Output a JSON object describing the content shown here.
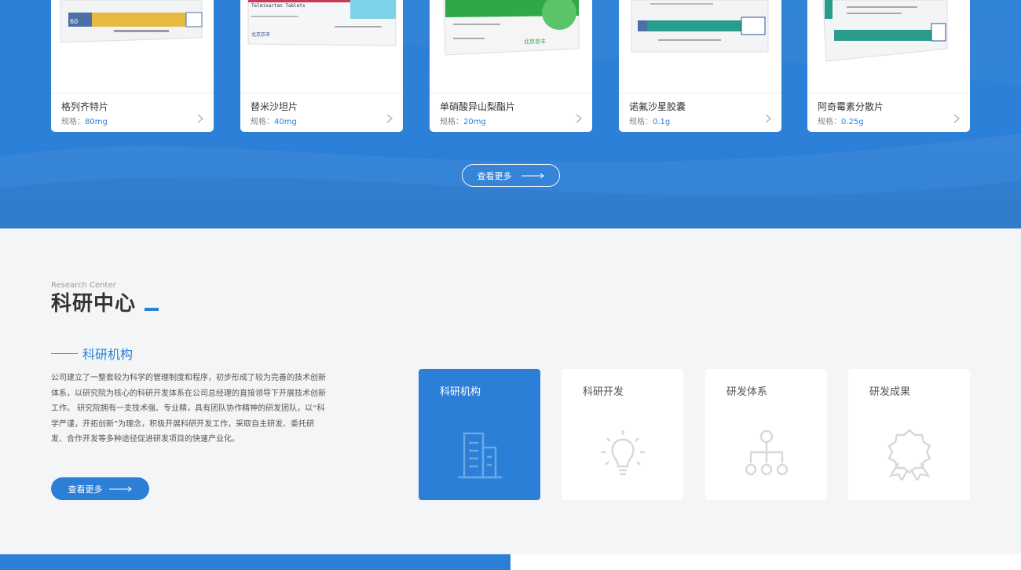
{
  "products": [
    {
      "name": "格列齐特片",
      "spec_label": "规格：",
      "spec_value": "80mg",
      "box_color": "#e8b941"
    },
    {
      "name": "替米沙坦片",
      "spec_label": "规格：",
      "spec_value": "40mg",
      "box_color": "#c83a5a",
      "box_text": "Telmisartan Tablets"
    },
    {
      "name": "单硝酸异山梨酯片",
      "spec_label": "规格：",
      "spec_value": "20mg",
      "box_color": "#2fa84a"
    },
    {
      "name": "诺氟沙星胶囊",
      "spec_label": "规格：",
      "spec_value": "0.1g",
      "box_color": "#2a9c8c"
    },
    {
      "name": "阿奇霉素分散片",
      "spec_label": "规格：",
      "spec_value": "0.25g",
      "box_color": "#2a9c8c"
    }
  ],
  "products_more": "查看更多",
  "research": {
    "en_title": "Research Center",
    "title": "科研中心",
    "subtitle": "科研机构",
    "description": "公司建立了一整套较为科学的管理制度和程序，初步形成了较为完善的技术创新体系，以研究院为核心的科研开发体系在公司总经理的直接领导下开展技术创新工作。 研究院拥有一支技术强、专业精，具有团队协作精神的研发团队，以“科学严谨，开拓创新”为理念，积极开展科研开发工作，采取自主研发、委托研发、合作开发等多种途径促进研发项目的快速产业化。",
    "more": "查看更多",
    "cards": [
      {
        "label": "科研机构",
        "icon": "building-icon",
        "active": true
      },
      {
        "label": "科研开发",
        "icon": "lightbulb-icon",
        "active": false
      },
      {
        "label": "研发体系",
        "icon": "hierarchy-icon",
        "active": false
      },
      {
        "label": "研发成果",
        "icon": "award-icon",
        "active": false
      }
    ]
  },
  "colors": {
    "accent": "#2b7fd6",
    "background": "#f4f5f7"
  }
}
